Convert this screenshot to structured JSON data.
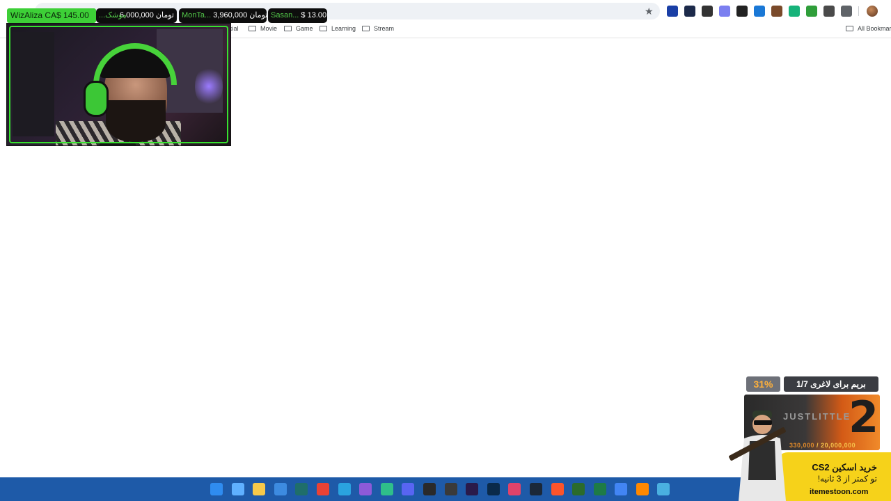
{
  "ticker": [
    {
      "name": "WizAliza",
      "amount": "CA$ 145.00"
    },
    {
      "name": "...موشک",
      "amount": "6,000,000 تومان"
    },
    {
      "name": "MonTa...",
      "amount": "3,960,000 تومان"
    },
    {
      "name": "Sasan...",
      "amount": "$ 13.00"
    }
  ],
  "bookmarks": {
    "items": [
      {
        "label": "cial"
      },
      {
        "label": "Movie"
      },
      {
        "label": "Game"
      },
      {
        "label": "Learning"
      },
      {
        "label": "Stream"
      }
    ],
    "all_bookmarks": "All Bookmark"
  },
  "extensions": [
    {
      "icon": "shield-extension-icon",
      "color": "#1a3fa6"
    },
    {
      "icon": "screen-extension-icon",
      "color": "#1c2a4a"
    },
    {
      "icon": "slash-extension-icon",
      "color": "#333333"
    },
    {
      "icon": "translate-extension-icon",
      "color": "#7b7ff0"
    },
    {
      "icon": "gear-extension-icon",
      "color": "#222222"
    },
    {
      "icon": "diamond-extension-icon",
      "color": "#1a78d6"
    },
    {
      "icon": "game-extension-icon",
      "color": "#7a4a2a"
    },
    {
      "icon": "shield-green-extension-icon",
      "color": "#17b37a"
    },
    {
      "icon": "leaf-extension-icon",
      "color": "#2f9e3a"
    },
    {
      "icon": "capture-extension-icon",
      "color": "#4a4a4a"
    },
    {
      "icon": "puzzle-icon",
      "color": "#5f6368"
    }
  ],
  "ad": {
    "percent": "31%",
    "title": "بریم برای لاغری 1/7",
    "banner_text": "JUSTLITTLE",
    "big_number": "2",
    "price_old": "330,000",
    "price_sep": " / ",
    "price_new": "20,000,000",
    "line1": "خرید اسکین CS2",
    "line2": "تو کمتر از 3 ثانیه!",
    "site": "itemestoon.com"
  },
  "taskbar": {
    "icons": [
      {
        "name": "windows-start-icon",
        "color": "#2f8cf0"
      },
      {
        "name": "copilot-icon",
        "color": "#5fb0ff"
      },
      {
        "name": "file-explorer-icon",
        "color": "#f6c94a"
      },
      {
        "name": "ms-store-icon",
        "color": "#3d8be0"
      },
      {
        "name": "app-icon",
        "color": "#1f6e6a"
      },
      {
        "name": "chrome-icon",
        "color": "#e94235"
      },
      {
        "name": "telegram-icon",
        "color": "#2aa3df"
      },
      {
        "name": "visual-studio-icon",
        "color": "#8e5ad8"
      },
      {
        "name": "edge-icon",
        "color": "#2fbf8a"
      },
      {
        "name": "discord-icon",
        "color": "#5865f2"
      },
      {
        "name": "obs-icon",
        "color": "#2a2a2a"
      },
      {
        "name": "app-red-dot-icon",
        "color": "#3a3a3a"
      },
      {
        "name": "premiere-icon",
        "color": "#2a1a4a"
      },
      {
        "name": "photoshop-icon",
        "color": "#0a2a4a"
      },
      {
        "name": "maps-icon",
        "color": "#e0436a"
      },
      {
        "name": "steam-icon",
        "color": "#1b2838"
      },
      {
        "name": "brave-icon",
        "color": "#fb542b"
      },
      {
        "name": "winamp-icon",
        "color": "#2b6b2b"
      },
      {
        "name": "excel-icon",
        "color": "#1e7b45"
      },
      {
        "name": "chrome-alt-icon",
        "color": "#4285f4"
      },
      {
        "name": "vlc-icon",
        "color": "#ff8800"
      },
      {
        "name": "notepad-icon",
        "color": "#4ab0e0"
      }
    ]
  }
}
